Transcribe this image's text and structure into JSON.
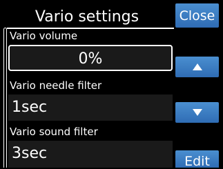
{
  "header": {
    "title": "Vario settings"
  },
  "fields": [
    {
      "label": "Vario volume",
      "value": "0%"
    },
    {
      "label": "Vario needle filter",
      "value": "1sec"
    },
    {
      "label": "Vario sound filter",
      "value": "3sec"
    }
  ],
  "buttons": {
    "close_label": "Close",
    "up_icon": "triangle-up-icon",
    "down_icon": "triangle-down-icon",
    "edit_label": "Edit"
  },
  "colors": {
    "background": "#000000",
    "button": "#3b7cc4",
    "field_bg": "#1a1a1a",
    "text": "#ffffff"
  }
}
